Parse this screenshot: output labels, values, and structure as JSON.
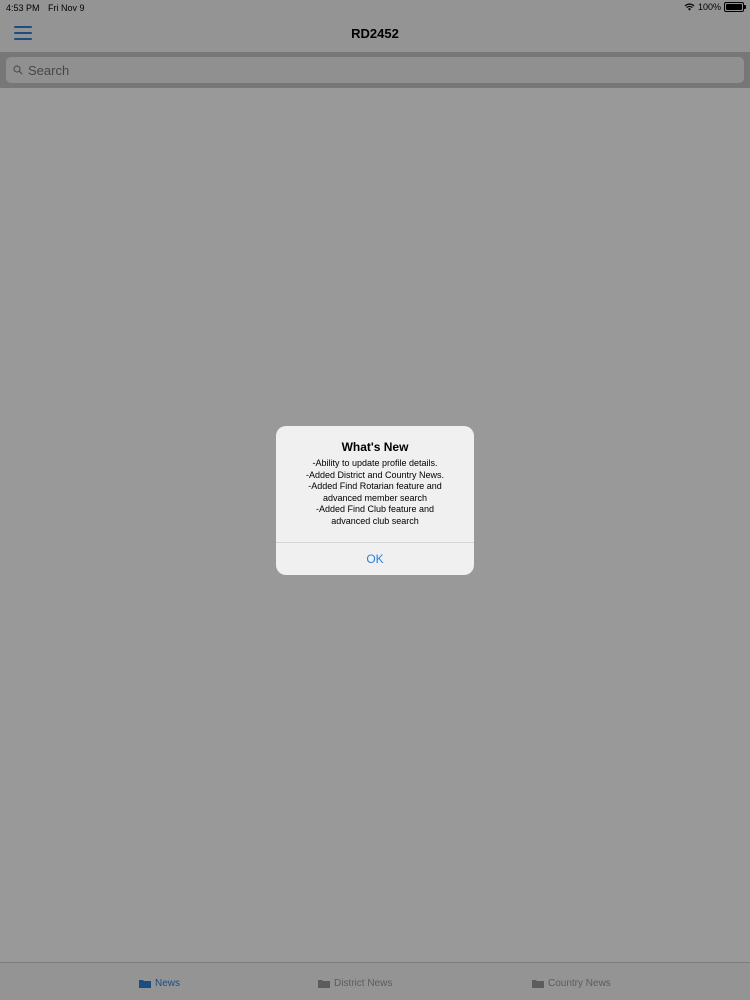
{
  "status_bar": {
    "time": "4:53 PM",
    "date": "Fri Nov 9",
    "battery": "100%",
    "battery_level": 1.0,
    "icons": [
      "wifi-icon",
      "battery-icon"
    ]
  },
  "nav": {
    "title": "RD2452",
    "menu_icon": "hamburger-menu-icon"
  },
  "search": {
    "placeholder": "Search",
    "icon": "search-icon"
  },
  "alert": {
    "title": "What's New",
    "lines": [
      "-Ability to update profile details.",
      "-Added District and Country News.",
      "-Added Find Rotarian feature and",
      "advanced member search",
      "-Added Find Club feature and",
      "advanced club search"
    ],
    "ok_label": "OK"
  },
  "tabs": [
    {
      "label": "News",
      "active": true,
      "icon": "folder-icon"
    },
    {
      "label": "District News",
      "active": false,
      "icon": "folder-icon"
    },
    {
      "label": "Country News",
      "active": false,
      "icon": "folder-icon"
    }
  ],
  "colors": {
    "accent": "#2f7fd6",
    "tab_inactive": "#999999",
    "dim_overlay": "rgba(0,0,0,0.4)"
  }
}
